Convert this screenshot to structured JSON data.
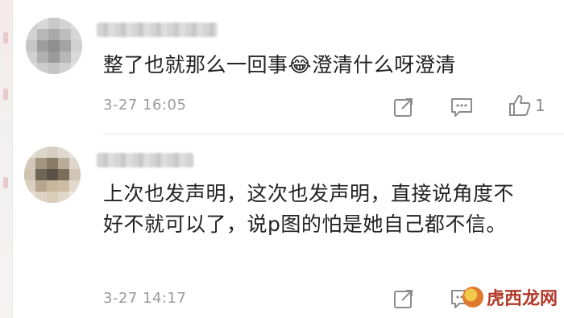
{
  "comments": [
    {
      "text": "整了也就那么一回事😂澄清什么呀澄清",
      "time": "3-27 16:05"
    },
    {
      "text": "上次也发声明，这次也发声明，直接说角度不好不就可以了，说p图的怕是她自己都不信。",
      "time": "3-27 14:17"
    }
  ],
  "actions": {
    "share_icon": "share-icon",
    "reply_icon": "comment-icon",
    "like_icon": "thumbs-up-icon",
    "like_count": "1"
  },
  "watermark": {
    "text": "虎西龙网"
  },
  "colors": {
    "text": "#222222",
    "meta": "#9a9a9a",
    "icon": "#8c8c8c",
    "watermark": "#b23a2a"
  }
}
